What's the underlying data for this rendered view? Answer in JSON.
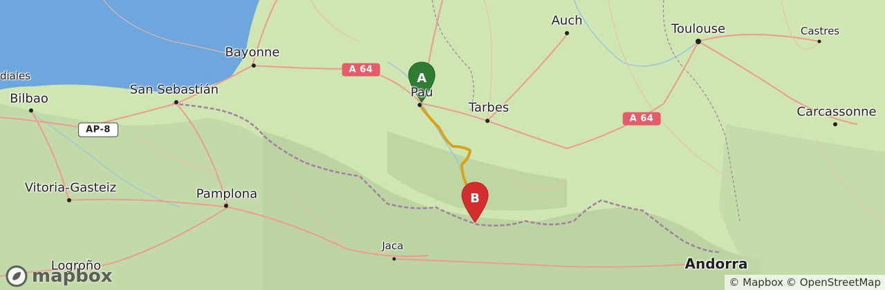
{
  "cities": [
    {
      "name": "Auch",
      "size": "md"
    },
    {
      "name": "Toulouse",
      "size": "md"
    },
    {
      "name": "Castres",
      "size": "sm"
    },
    {
      "name": "Bayonne",
      "size": "md"
    },
    {
      "name": "San Sebastián",
      "size": "md"
    },
    {
      "name": "Bilbao",
      "size": "md"
    },
    {
      "name": "Tarbes",
      "size": "md"
    },
    {
      "name": "Carcassonne",
      "size": "md"
    },
    {
      "name": "Vitoria-Gasteiz",
      "size": "md"
    },
    {
      "name": "Pamplona",
      "size": "md"
    },
    {
      "name": "Jaca",
      "size": "sm"
    },
    {
      "name": "Logroño",
      "size": "md"
    },
    {
      "name": "Andorra",
      "size": "lg"
    },
    {
      "name": "Pau",
      "size": "md"
    },
    {
      "name": "diales",
      "size": "sm"
    }
  ],
  "road_shields": [
    {
      "label": "A 64",
      "style": "red"
    },
    {
      "label": "A 64",
      "style": "red"
    },
    {
      "label": "AP-8",
      "style": "white"
    }
  ],
  "markers": [
    {
      "label": "A",
      "color": "#2e7d32",
      "role": "start"
    },
    {
      "label": "B",
      "color": "#d32f2f",
      "role": "end"
    }
  ],
  "route": {
    "color": "#d9a21a"
  },
  "logo": {
    "text": "mapbox"
  },
  "attribution": {
    "mapbox": "© Mapbox",
    "osm": "© OpenStreetMap"
  },
  "colors": {
    "sea": "#6ea7dd",
    "land": "#cfe5b2",
    "mountain": "#b6d09c",
    "road": "#ef9a8f",
    "border": "#a47ca4"
  }
}
